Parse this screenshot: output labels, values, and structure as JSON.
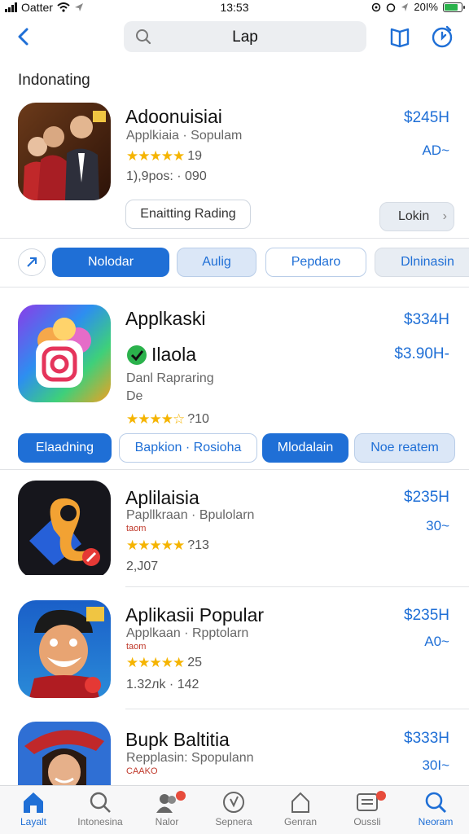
{
  "status": {
    "carrier": "Oatter",
    "time": "13:53",
    "battery": "20I%"
  },
  "search": {
    "query": "Lap"
  },
  "section_title": "Indonating",
  "apps": [
    {
      "name": "Adoonuisiai",
      "subtitle": "Applkiaia · Sopulam",
      "rating": "19",
      "meta": "1),9pos: · 090",
      "price": "$245H",
      "price2": "AD~",
      "rating_value": 5
    },
    {
      "name": "Applkaski",
      "name2": "Ilaola",
      "subtitle": "Danl  Rapraring",
      "subtitle2": "De",
      "rating": "?10",
      "price": "$334H",
      "price2": "$3.90H-",
      "rating_value": 4
    },
    {
      "name": "Aplilaisia",
      "subtitle": "Papllkraan · Bpulolarn",
      "tiny": "taom",
      "rating": "?13",
      "meta": "2,J07",
      "price": "$235H",
      "price2": "30~",
      "rating_value": 5
    },
    {
      "name": "Aplikasii Popular",
      "subtitle": "Applkaan · Rpptolarn",
      "tiny": "taom",
      "rating": "25",
      "meta": "1.32лk · 142",
      "price": "$235H",
      "price2": "A0~",
      "rating_value": 5
    },
    {
      "name": "Bupk Baltitia",
      "subtitle": "Repplasin:  Spopulann",
      "tiny": "CAAKO",
      "price": "$333H",
      "price2": "30I~"
    }
  ],
  "row1_buttons": {
    "left": "Enaitting  Rading",
    "right": "Lokin"
  },
  "chips": [
    "Nolodar",
    "Aulig",
    "Pepdaro",
    "Dlninasin"
  ],
  "row2_buttons": [
    "Elaadning",
    "Bapkion · Rosioha",
    "Mlodalain",
    "Noe reatem"
  ],
  "tabs": [
    {
      "label": "Layalt",
      "icon": "home-icon"
    },
    {
      "label": "Intonesina",
      "icon": "search-icon"
    },
    {
      "label": "Nalor",
      "icon": "people-icon"
    },
    {
      "label": "Sepnera",
      "icon": "compass-icon"
    },
    {
      "label": "Genran",
      "icon": "house-outline-icon"
    },
    {
      "label": "Oussli",
      "icon": "list-icon"
    },
    {
      "label": "Neoram",
      "icon": "search-icon"
    }
  ],
  "colors": {
    "accent": "#1f6fd6",
    "star": "#f5b400",
    "badge": "#e74c3c"
  }
}
